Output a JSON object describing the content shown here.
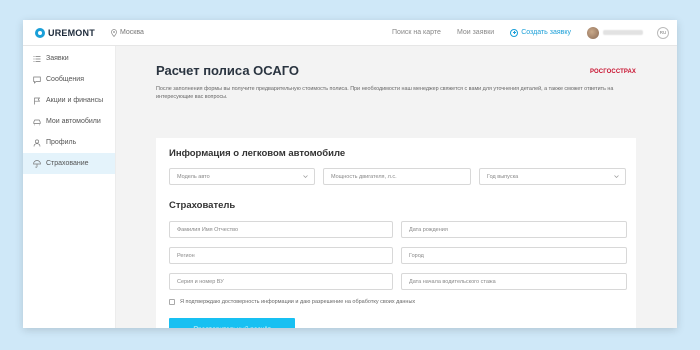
{
  "header": {
    "logo_text": "UREMONT",
    "city": "Москва",
    "nav": {
      "map": "Поиск на карте",
      "requests": "Мои заявки",
      "create": "Создать заявку"
    },
    "user_name": "",
    "lang": "RU"
  },
  "sidebar": {
    "items": [
      {
        "label": "Заявки",
        "icon": "list-icon"
      },
      {
        "label": "Сообщения",
        "icon": "chat-icon"
      },
      {
        "label": "Акции и финансы",
        "icon": "flag-icon"
      },
      {
        "label": "Мои автомобили",
        "icon": "car-icon"
      },
      {
        "label": "Профиль",
        "icon": "user-icon"
      },
      {
        "label": "Страхование",
        "icon": "umbrella-icon",
        "active": true
      }
    ]
  },
  "main": {
    "title": "Расчет полиса ОСАГО",
    "brand": "РОСГОССТРАХ",
    "description": "После заполнения формы вы получите предварительную стоимость полиса. При необходимости наш менеджер свяжется с вами для уточнения деталей, а также сможет ответить на интересующие вас вопросы.",
    "car_section": {
      "title": "Информация о легковом автомобиле",
      "model_placeholder": "Модель авто",
      "power_placeholder": "Мощность двигателя, л.с.",
      "year_placeholder": "Год выпуска"
    },
    "insured_section": {
      "title": "Страхователь",
      "full_name": "Фамилия Имя Отчество",
      "birth_date": "Дата рождения",
      "region": "Регион",
      "city": "Город",
      "license": "Серия и номер ВУ",
      "experience_start": "Дата начала водительского стажа"
    },
    "consent": "Я подтверждаю достоверность информации и даю разрешение на обработку своих данных",
    "submit": "Предварительный расчёт"
  },
  "colors": {
    "accent": "#18c0f2",
    "link": "#1a9fd8",
    "brand": "#c8102e",
    "background": "#cfe8f8"
  }
}
